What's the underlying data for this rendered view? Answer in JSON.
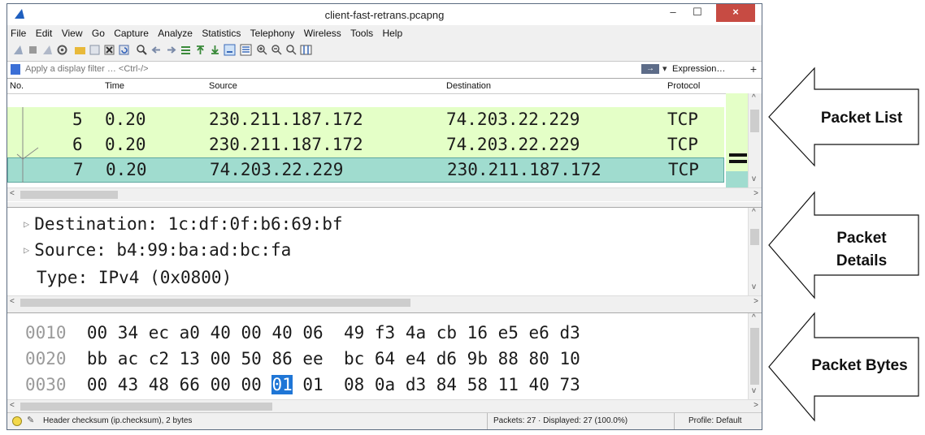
{
  "window": {
    "title": "client-fast-retrans.pcapng",
    "minimize": "–",
    "maximize": "☐",
    "close": "×"
  },
  "menu": [
    "File",
    "Edit",
    "View",
    "Go",
    "Capture",
    "Analyze",
    "Statistics",
    "Telephony",
    "Wireless",
    "Tools",
    "Help"
  ],
  "filter": {
    "placeholder": "Apply a display filter … <Ctrl-/>",
    "expression_label": "Expression…",
    "add_label": "+"
  },
  "packet_list": {
    "columns": [
      "No.",
      "Time",
      "Source",
      "Destination",
      "Protocol"
    ],
    "rows": [
      {
        "no": "5",
        "time": "0.20",
        "source": "230.211.187.172",
        "destination": "74.203.22.229",
        "protocol": "TCP"
      },
      {
        "no": "6",
        "time": "0.20",
        "source": "230.211.187.172",
        "destination": "74.203.22.229",
        "protocol": "TCP"
      },
      {
        "no": "7",
        "time": "0.20",
        "source": "74.203.22.229",
        "destination": "230.211.187.172",
        "protocol": "TCP"
      }
    ]
  },
  "packet_details": {
    "lines": [
      "Destination: 1c:df:0f:b6:69:bf",
      "Source: b4:99:ba:ad:bc:fa",
      "Type: IPv4 (0x0800)"
    ]
  },
  "packet_bytes": {
    "rows": [
      {
        "offset": "0010",
        "bytes_a": "00 34 ec a0 40 00 40 06",
        "bytes_b": "49 f3 4a cb 16 e5 e6 d3"
      },
      {
        "offset": "0020",
        "bytes_a": "bb ac c2 13 00 50 86 ee",
        "bytes_b": "bc 64 e4 d6 9b 88 80 10"
      },
      {
        "offset": "0030",
        "bytes_a_pre": "00 43 48 66 00 00 ",
        "bytes_a_sel": "01",
        "bytes_a_post": " 01",
        "bytes_b": "08 0a d3 84 58 11 40 73"
      }
    ]
  },
  "status": {
    "field_info": "Header checksum (ip.checksum), 2 bytes",
    "packets": "Packets: 27 · Displayed: 27 (100.0%)",
    "profile": "Profile: Default"
  },
  "callouts": {
    "packet_list": "Packet List",
    "packet_details": "Packet Details",
    "packet_bytes": "Packet Bytes"
  },
  "colors": {
    "row_green": "#e4ffc7",
    "row_selected": "#a0dccf",
    "byte_selected": "#1f76d6"
  }
}
